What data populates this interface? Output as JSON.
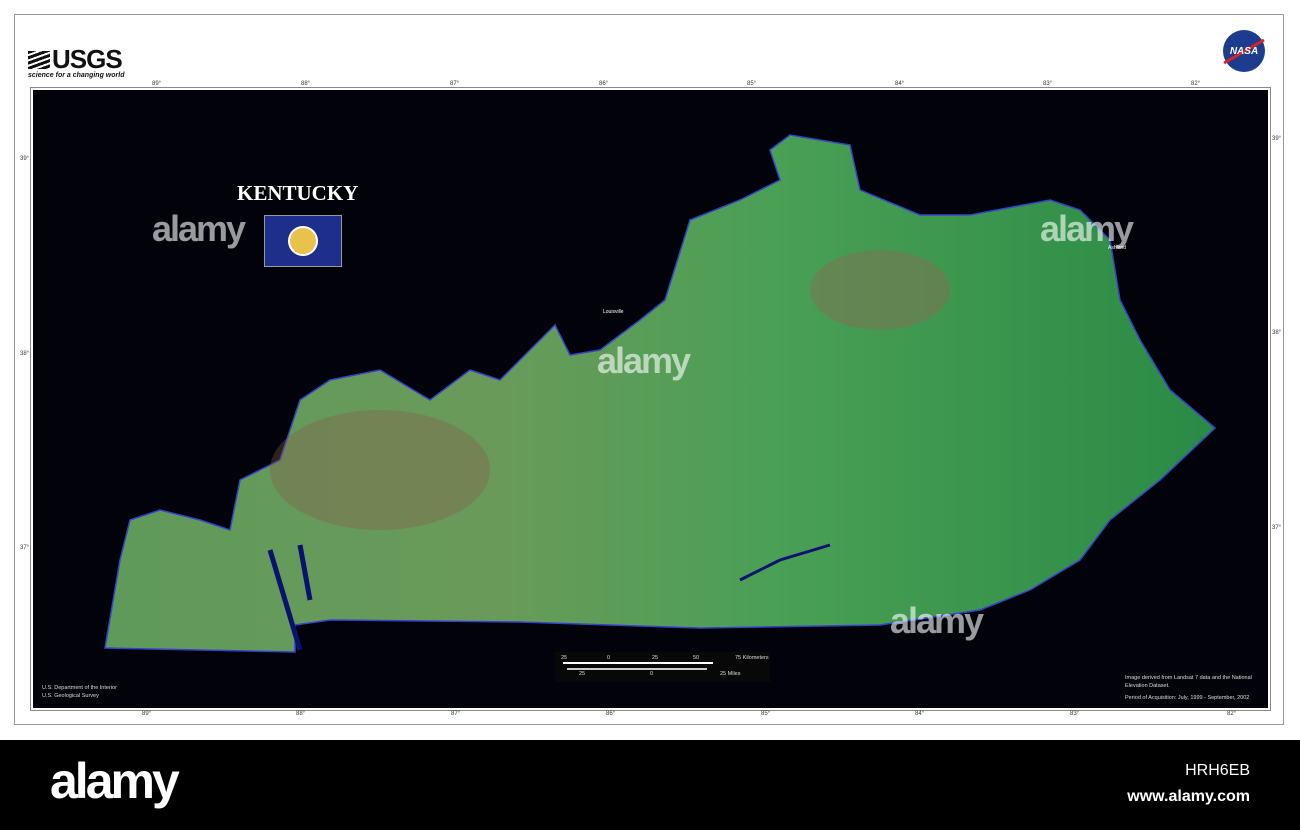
{
  "header": {
    "usgs_logo": "USGS",
    "usgs_tagline": "science for a changing world",
    "nasa_logo": "NASA"
  },
  "map": {
    "title": "KENTUCKY",
    "flag": "Kentucky state flag",
    "longitude_top": [
      "89°",
      "88°",
      "87°",
      "86°",
      "85°",
      "84°",
      "83°",
      "82°"
    ],
    "longitude_bottom": [
      "89°",
      "88°",
      "87°",
      "86°",
      "85°",
      "84°",
      "83°",
      "82°"
    ],
    "latitude_left": [
      "39°",
      "38°",
      "37°"
    ],
    "latitude_right": [
      "39°",
      "38°",
      "37°"
    ],
    "cities": [
      "Louisville",
      "Ashland"
    ],
    "credit_left": [
      "U.S. Department of the Interior",
      "U.S. Geological Survey"
    ],
    "credit_right": [
      "Image derived from Landsat 7 data and the National Elevation Dataset.",
      "Period of Acquisition: July, 1999 - September, 2002"
    ],
    "scale": {
      "km_labels": [
        "25",
        "0",
        "25",
        "50",
        "75 Kilometers"
      ],
      "mile_labels": [
        "25",
        "0",
        "25 Miles"
      ]
    },
    "colors": {
      "land": "#3f9a4e",
      "land_east": "#2f8a45",
      "water": "#000a5a",
      "background": "#02030a"
    }
  },
  "watermarks": [
    "alamy",
    "alamy",
    "alamy",
    "alamy"
  ],
  "footer": {
    "logo": "alamy",
    "image_id": "HRH6EB",
    "url": "www.alamy.com"
  }
}
